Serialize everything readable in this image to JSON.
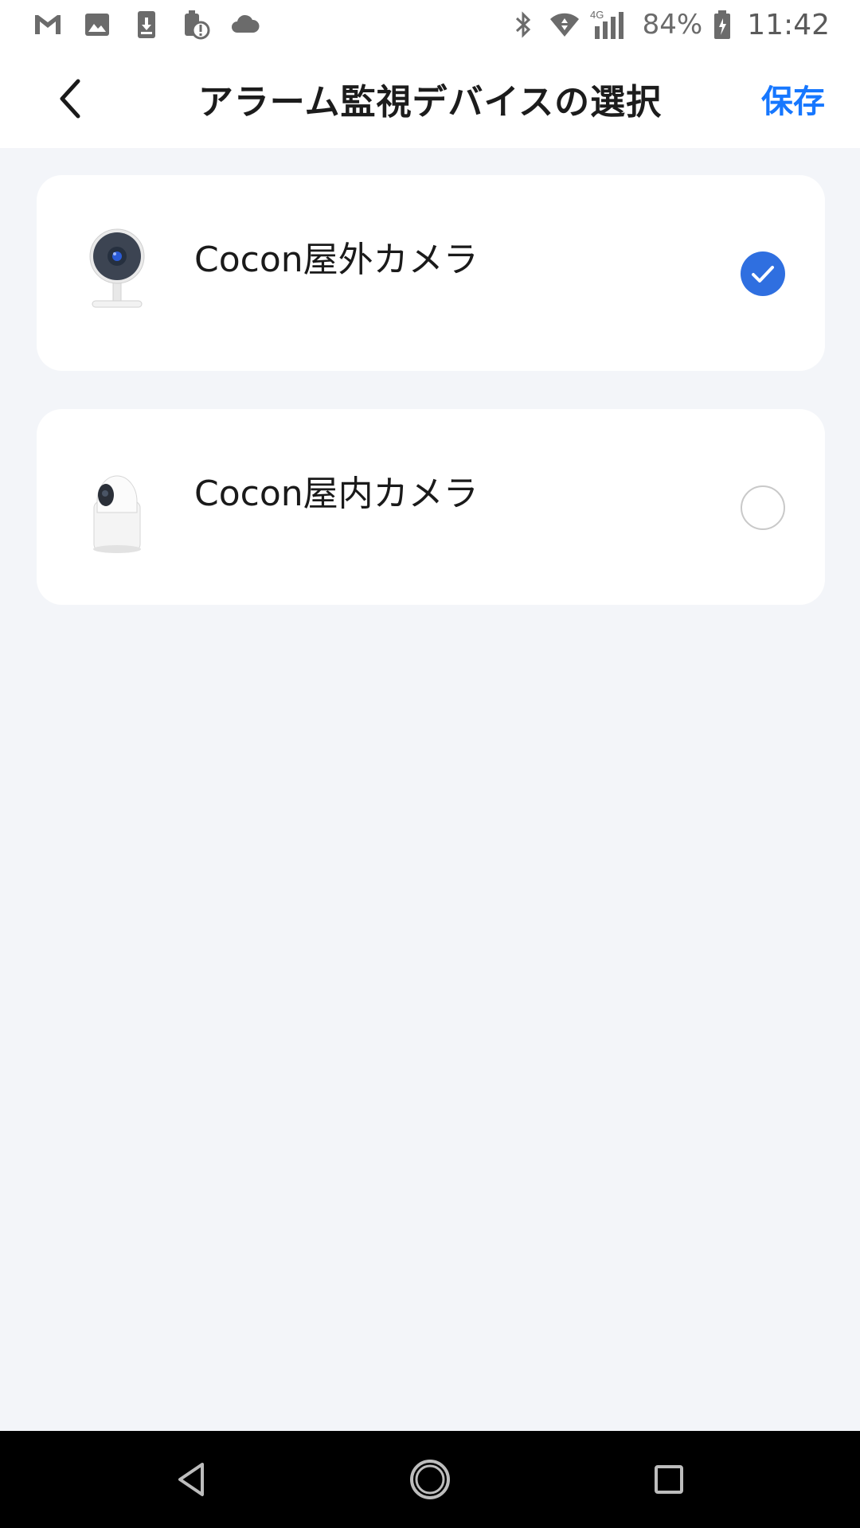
{
  "status_bar": {
    "left_icons": [
      "gmail-icon",
      "image-icon",
      "download-icon",
      "alert-icon",
      "cloud-icon"
    ],
    "right_icons": [
      "bluetooth-icon",
      "wifi-icon"
    ],
    "network": "4G",
    "battery": "84%",
    "time": "11:42"
  },
  "header": {
    "title": "アラーム監視デバイスの選択",
    "save_label": "保存",
    "accent_color": "#1677ff"
  },
  "devices": [
    {
      "name": "Cocon屋外カメラ",
      "icon": "outdoor-camera-icon",
      "selected": true
    },
    {
      "name": "Cocon屋内カメラ",
      "icon": "indoor-camera-icon",
      "selected": false
    }
  ],
  "nav": [
    "back-nav-icon",
    "home-nav-icon",
    "recents-nav-icon"
  ]
}
